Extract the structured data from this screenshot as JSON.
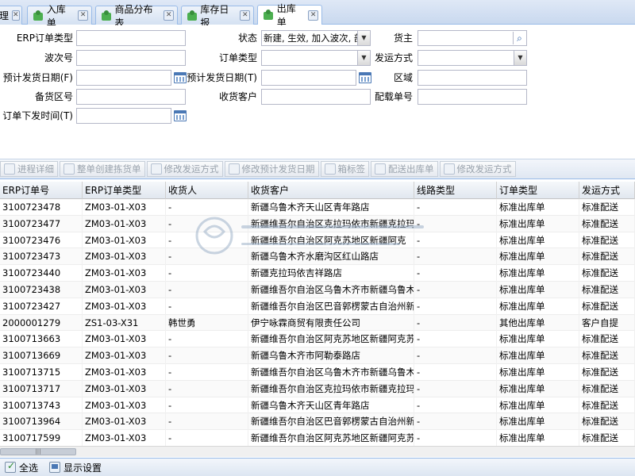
{
  "tabs": [
    {
      "label": "理",
      "active": false,
      "has_icon": false
    },
    {
      "label": "入库单",
      "active": false,
      "has_icon": true
    },
    {
      "label": "商品分布表",
      "active": false,
      "has_icon": true
    },
    {
      "label": "库存日报",
      "active": false,
      "has_icon": true
    },
    {
      "label": "出库单",
      "active": true,
      "has_icon": true
    }
  ],
  "form": {
    "erp_order_type_label": "ERP订单类型",
    "erp_order_type_value": "",
    "status_label": "状态",
    "status_value": "新建, 生效, 加入波次, 部",
    "owner_label": "货主",
    "owner_value": "",
    "wave_no_label": "波次号",
    "wave_no_value": "",
    "order_type_label": "订单类型",
    "order_type_value": "",
    "ship_method_label": "发运方式",
    "ship_method_value": "",
    "est_ship_date_f_label": "预计发货日期(F)",
    "est_ship_date_f_value": "",
    "est_ship_date_t_label": "预计发货日期(T)",
    "est_ship_date_t_value": "",
    "area_label": "区域",
    "area_value": "",
    "stock_area_label": "备货区号",
    "stock_area_value": "",
    "receiver_label": "收货客户",
    "receiver_value": "",
    "load_no_label": "配载单号",
    "load_no_value": "",
    "order_time_label": "订单下发时间(T)",
    "order_time_value": ""
  },
  "toolbar": {
    "progress_detail": "进程详细",
    "whole_order_pick": "整单创建拣货单",
    "edit_ship_method": "修改发运方式",
    "edit_est_ship_date": "修改预计发货日期",
    "box_label": "箱标签",
    "dispatch_out_order": "配送出库单",
    "edit_ship_method_2": "修改发运方式"
  },
  "grid": {
    "columns": [
      "ERP订单号",
      "ERP订单类型",
      "收货人",
      "收货客户",
      "线路类型",
      "订单类型",
      "发运方式"
    ],
    "rows": [
      [
        "3100723478",
        "ZM03-01-X03",
        "-",
        "新疆乌鲁木齐天山区青年路店",
        "-",
        "标准出库单",
        "标准配送"
      ],
      [
        "3100723477",
        "ZM03-01-X03",
        "-",
        "新疆维吾尔自治区克拉玛依市新疆克拉玛",
        "-",
        "标准出库单",
        "标准配送"
      ],
      [
        "3100723476",
        "ZM03-01-X03",
        "-",
        "新疆维吾尔自治区阿克苏地区新疆阿克",
        "-",
        "标准出库单",
        "标准配送"
      ],
      [
        "3100723473",
        "ZM03-01-X03",
        "-",
        "新疆乌鲁木齐水磨沟区红山路店",
        "-",
        "标准出库单",
        "标准配送"
      ],
      [
        "3100723440",
        "ZM03-01-X03",
        "-",
        "新疆克拉玛依吉祥路店",
        "-",
        "标准出库单",
        "标准配送"
      ],
      [
        "3100723438",
        "ZM03-01-X03",
        "-",
        "新疆维吾尔自治区乌鲁木齐市新疆乌鲁木:",
        "-",
        "标准出库单",
        "标准配送"
      ],
      [
        "3100723427",
        "ZM03-01-X03",
        "-",
        "新疆维吾尔自治区巴音郭楞蒙古自治州新",
        "-",
        "标准出库单",
        "标准配送"
      ],
      [
        "2000001279",
        "ZS1-03-X31",
        "韩世勇",
        "伊宁咏霖商贸有限责任公司",
        "-",
        "其他出库单",
        "客户自提"
      ],
      [
        "3100713663",
        "ZM03-01-X03",
        "-",
        "新疆维吾尔自治区阿克苏地区新疆阿克苏i",
        "-",
        "标准出库单",
        "标准配送"
      ],
      [
        "3100713669",
        "ZM03-01-X03",
        "-",
        "新疆乌鲁木齐市阿勒泰路店",
        "-",
        "标准出库单",
        "标准配送"
      ],
      [
        "3100713715",
        "ZM03-01-X03",
        "-",
        "新疆维吾尔自治区乌鲁木齐市新疆乌鲁木:",
        "-",
        "标准出库单",
        "标准配送"
      ],
      [
        "3100713717",
        "ZM03-01-X03",
        "-",
        "新疆维吾尔自治区克拉玛依市新疆克拉玛",
        "-",
        "标准出库单",
        "标准配送"
      ],
      [
        "3100713743",
        "ZM03-01-X03",
        "-",
        "新疆乌鲁木齐天山区青年路店",
        "-",
        "标准出库单",
        "标准配送"
      ],
      [
        "3100713964",
        "ZM03-01-X03",
        "-",
        "新疆维吾尔自治区巴音郭楞蒙古自治州新",
        "-",
        "标准出库单",
        "标准配送"
      ],
      [
        "3100717599",
        "ZM03-01-X03",
        "-",
        "新疆维吾尔自治区阿克苏地区新疆阿克苏i",
        "-",
        "标准出库单",
        "标准配送"
      ]
    ]
  },
  "bottom": {
    "select_all": "全选",
    "display_settings": "显示设置"
  },
  "icons": {
    "tab_icon": "puzzle-icon",
    "calendar": "calendar-icon",
    "search": "search-icon"
  },
  "colors": {
    "tab_bar_bg": "#c9d9ef",
    "border_blue": "#99bbe8",
    "toolbar_disabled_text": "#9aa3ad"
  }
}
